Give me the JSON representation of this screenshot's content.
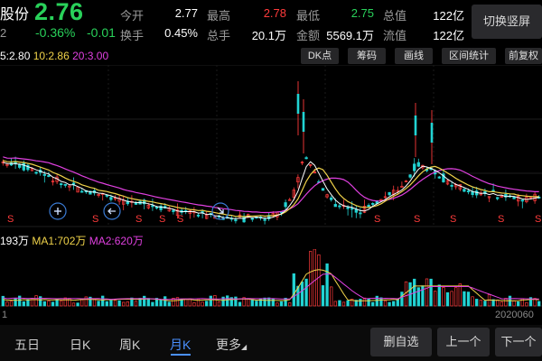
{
  "header": {
    "stock_name": "股份",
    "price": "2.76",
    "code_fragment": "2",
    "change_pct": "-0.36%",
    "change": "-0.01",
    "stats": [
      {
        "label": "今开",
        "value": "2.77",
        "color": "white"
      },
      {
        "label": "最高",
        "value": "2.78",
        "color": "red"
      },
      {
        "label": "最低",
        "value": "2.75",
        "color": "green"
      },
      {
        "label": "总值",
        "value": "122亿",
        "color": "white"
      },
      {
        "label": "换手",
        "value": "0.45%",
        "color": "white"
      },
      {
        "label": "总手",
        "value": "20.1万",
        "color": "white"
      },
      {
        "label": "金额",
        "value": "5569.1万",
        "color": "white"
      },
      {
        "label": "流值",
        "value": "122亿",
        "color": "white"
      }
    ],
    "switch_label": "切换竖屏"
  },
  "ma_legend": {
    "ma5": "5:2.80",
    "ma10": "10:2.86",
    "ma20": "20:3.00"
  },
  "toolbar": [
    "DK点",
    "筹码",
    "画线",
    "区间统计",
    "前复权"
  ],
  "volume_legend": {
    "volume": "193万",
    "ma1": "MA1:702万",
    "ma2": "MA2:620万"
  },
  "axis": {
    "left_date": "1",
    "right_date": "2020060"
  },
  "markers": {
    "sell_letter": "S"
  },
  "bottom": {
    "tabs": [
      "五日",
      "日K",
      "周K",
      "月K",
      "更多"
    ],
    "active_tab": "月K",
    "buttons": [
      "删自选",
      "上一个",
      "下一个"
    ]
  },
  "colors": {
    "up": "#ff3b3b",
    "down": "#29d15a",
    "candle_down": "#22d3d3",
    "ma5": "#ffffff",
    "ma10": "#f0d34a",
    "ma20": "#e040e0",
    "accent": "#4a90ff"
  }
}
